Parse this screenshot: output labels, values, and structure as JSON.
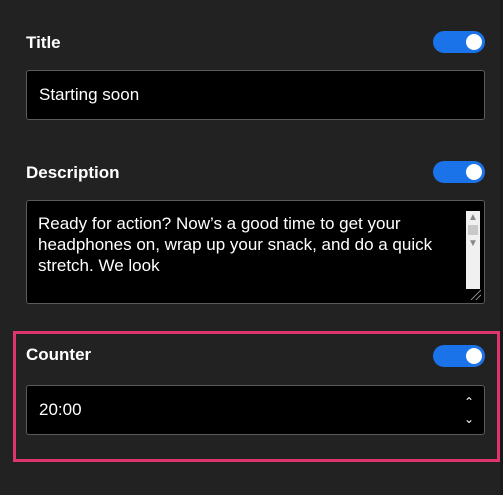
{
  "title_section": {
    "label": "Title",
    "toggle_on": true,
    "value": "Starting soon"
  },
  "description_section": {
    "label": "Description",
    "toggle_on": true,
    "value": "Ready for action? Now’s a good time to get your headphones on, wrap up your snack, and do a quick stretch. We look"
  },
  "counter_section": {
    "label": "Counter",
    "toggle_on": true,
    "value": "20:00"
  },
  "colors": {
    "accent": "#1a73e8",
    "highlight": "#e0346e",
    "background": "#222222"
  },
  "icons": {
    "scroll_up": "chevron-up-icon",
    "scroll_down": "chevron-down-icon",
    "resize": "resize-grip-icon",
    "spinner": "spinner-arrows-icon"
  }
}
